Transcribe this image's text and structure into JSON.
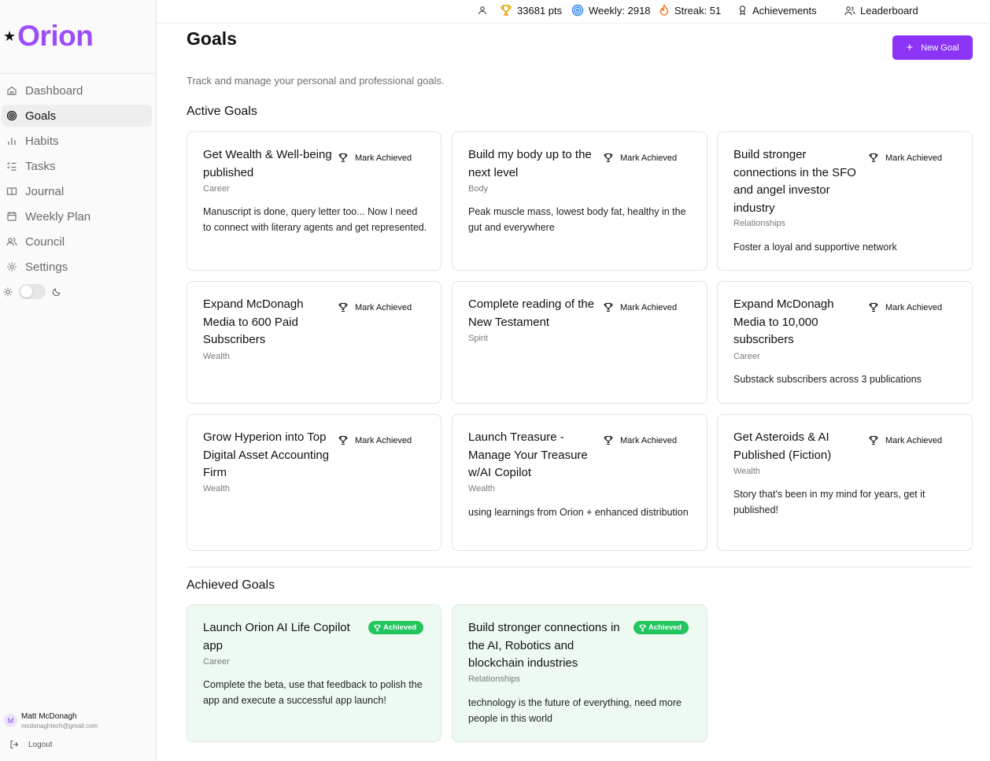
{
  "brand": {
    "star": "★",
    "name": "Orion"
  },
  "nav": [
    {
      "label": "Dashboard",
      "icon": "home-icon",
      "active": false
    },
    {
      "label": "Goals",
      "icon": "target-icon",
      "active": true
    },
    {
      "label": "Habits",
      "icon": "bar-chart-icon",
      "active": false
    },
    {
      "label": "Tasks",
      "icon": "list-check-icon",
      "active": false
    },
    {
      "label": "Journal",
      "icon": "book-icon",
      "active": false
    },
    {
      "label": "Weekly Plan",
      "icon": "calendar-icon",
      "active": false
    },
    {
      "label": "Council",
      "icon": "users-icon",
      "active": false
    },
    {
      "label": "Settings",
      "icon": "gear-icon",
      "active": false
    }
  ],
  "theme": {
    "light_icon": "sun-icon",
    "dark_icon": "moon-icon",
    "dark_mode": false
  },
  "user": {
    "initial": "M",
    "name": "Matt McDonagh",
    "email": "mcdonaghtech@gmail.com",
    "logout_label": "Logout"
  },
  "topbar": {
    "points": "33681 pts",
    "weekly": "Weekly: 2918",
    "streak": "Streak: 51",
    "achievements": "Achievements",
    "leaderboard": "Leaderboard"
  },
  "page": {
    "title": "Goals",
    "new_goal_label": "New Goal",
    "subtitle": "Track and manage your personal and professional goals.",
    "active_title": "Active Goals",
    "achieved_title": "Achieved Goals"
  },
  "mark_label": "Mark Achieved",
  "badge_label": "Achieved",
  "active_goals": [
    {
      "title": "Get Wealth & Well-being published",
      "category": "Career",
      "description": "Manuscript is done, query letter too... Now I need to connect with literary agents and get represented."
    },
    {
      "title": "Build my body up to the next level",
      "category": "Body",
      "description": "Peak muscle mass, lowest body fat, healthy in the gut and everywhere"
    },
    {
      "title": "Build stronger connections in the SFO and angel investor industry",
      "category": "Relationships",
      "description": "Foster a loyal and supportive network"
    },
    {
      "title": "Expand McDonagh Media to 600 Paid Subscribers",
      "category": "Wealth",
      "description": ""
    },
    {
      "title": "Complete reading of the New Testament",
      "category": "Spirit",
      "description": ""
    },
    {
      "title": "Expand McDonagh Media to 10,000 subscribers",
      "category": "Career",
      "description": "Substack subscribers across 3 publications"
    },
    {
      "title": "Grow Hyperion into Top Digital Asset Accounting Firm",
      "category": "Wealth",
      "description": ""
    },
    {
      "title": "Launch Treasure - Manage Your Treasure w/AI Copilot",
      "category": "Wealth",
      "description": "using learnings from Orion + enhanced distribution"
    },
    {
      "title": "Get Asteroids & AI Published (Fiction)",
      "category": "Wealth",
      "description": "Story that's been in my mind for years, get it published!"
    }
  ],
  "achieved_goals": [
    {
      "title": "Launch Orion AI Life Copilot app",
      "category": "Career",
      "description": "Complete the beta, use that feedback to polish the app and execute a successful app launch!"
    },
    {
      "title": "Build stronger connections in the AI, Robotics and blockchain industries",
      "category": "Relationships",
      "description": "technology is the future of everything, need more people in this world"
    }
  ],
  "colors": {
    "brand": "#9b4dfa",
    "primary_button": "#8b34f5",
    "achieved_badge": "#22c55e",
    "achieved_card": "#eefaf1",
    "trophy": "#e0a100",
    "streak": "#f97316",
    "weekly": "#2f80ed"
  }
}
